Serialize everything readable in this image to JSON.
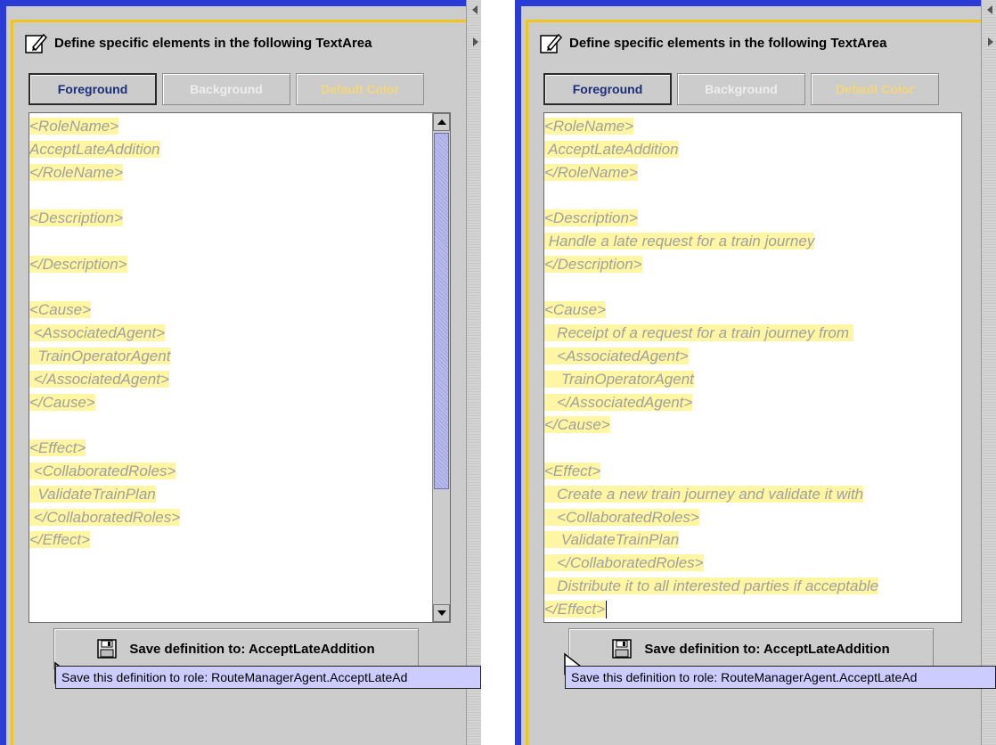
{
  "left": {
    "header": "Define specific elements in the following TextArea",
    "buttons": {
      "foreground": "Foreground",
      "background": "Background",
      "default_color": "Default Color"
    },
    "lines": [
      "<RoleName>",
      "AcceptLateAddition",
      "</RoleName>",
      "",
      "<Description>",
      "",
      "</Description>",
      "",
      "<Cause>",
      " <AssociatedAgent>",
      "  TrainOperatorAgent",
      " </AssociatedAgent>",
      "</Cause>",
      "",
      "<Effect>",
      " <CollaboratedRoles>",
      "  ValidateTrainPlan",
      " </CollaboratedRoles>",
      "</Effect>"
    ],
    "save_label": "Save definition to: AcceptLateAddition",
    "tooltip": "Save this definition to role: RouteManagerAgent.AcceptLateAd"
  },
  "right": {
    "header": "Define specific elements in the following TextArea",
    "buttons": {
      "foreground": "Foreground",
      "background": "Background",
      "default_color": "Default Color"
    },
    "lines": [
      "<RoleName>",
      " AcceptLateAddition",
      "</RoleName>",
      "",
      "<Description>",
      " Handle a late request for a train journey",
      "</Description>",
      "",
      "<Cause>",
      "   Receipt of a request for a train journey from ",
      "   <AssociatedAgent>",
      "    TrainOperatorAgent",
      "   </AssociatedAgent>",
      "</Cause>",
      "",
      "<Effect>",
      "   Create a new train journey and validate it with",
      "   <CollaboratedRoles>",
      "    ValidateTrainPlan",
      "   </CollaboratedRoles>",
      "   Distribute it to all interested parties if acceptable",
      "</Effect>"
    ],
    "save_label": "Save definition to: AcceptLateAddition",
    "tooltip": "Save this definition to role: RouteManagerAgent.AcceptLateAd"
  },
  "colors": {
    "panel_bg": "#cccccc",
    "frame_gold": "#f2c51c",
    "window_blue": "#2b3bd6",
    "highlight": "#fff6a3",
    "text_gray": "#a0a0a0",
    "tooltip_bg": "#ccccff"
  }
}
